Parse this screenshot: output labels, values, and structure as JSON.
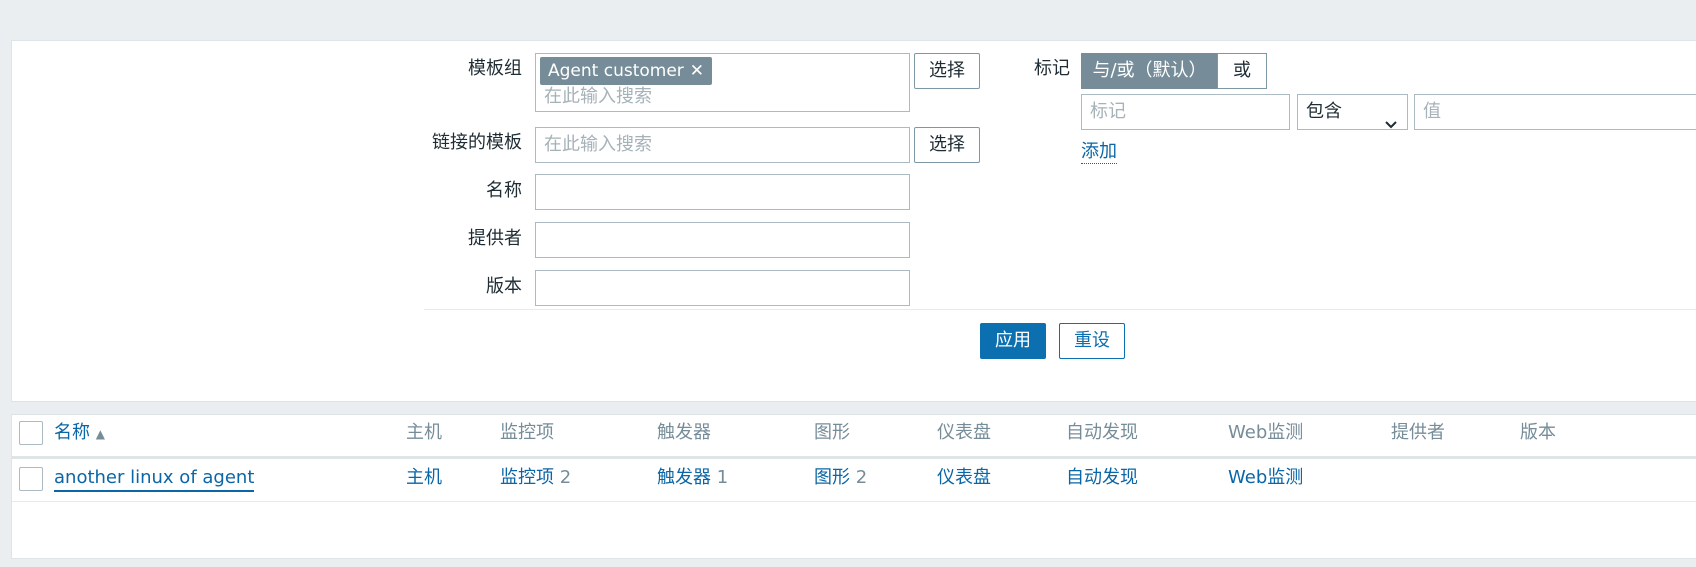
{
  "filter": {
    "template_group_label": "模板组",
    "template_group_chip": "Agent customer",
    "template_group_placeholder": "在此输入搜索",
    "select_label": "选择",
    "linked_templates_label": "链接的模板",
    "linked_templates_placeholder": "在此输入搜索",
    "name_label": "名称",
    "name_value": "",
    "vendor_label": "提供者",
    "vendor_value": "",
    "version_label": "版本",
    "version_value": "",
    "tags_label": "标记",
    "tag_mode_and_or": "与/或（默认）",
    "tag_mode_or": "或",
    "tag_name_placeholder": "标记",
    "tag_operator": "包含",
    "tag_value_placeholder": "值",
    "add_link": "添加",
    "apply_button": "应用",
    "reset_button": "重设"
  },
  "table": {
    "headers": {
      "name": "名称",
      "hosts": "主机",
      "items": "监控项",
      "triggers": "触发器",
      "graphs": "图形",
      "dashboards": "仪表盘",
      "discovery": "自动发现",
      "web": "Web监测",
      "vendor": "提供者",
      "version": "版本"
    },
    "rows": [
      {
        "name": "another linux of agent",
        "hosts": "主机",
        "items": "监控项",
        "items_count": "2",
        "triggers": "触发器",
        "triggers_count": "1",
        "graphs": "图形",
        "graphs_count": "2",
        "dashboards": "仪表盘",
        "discovery": "自动发现",
        "web": "Web监测"
      }
    ]
  },
  "colors": {
    "link": "#0a66a6",
    "chip": "#768d99",
    "primary": "#0b6fb0",
    "background": "#ebeef0"
  }
}
